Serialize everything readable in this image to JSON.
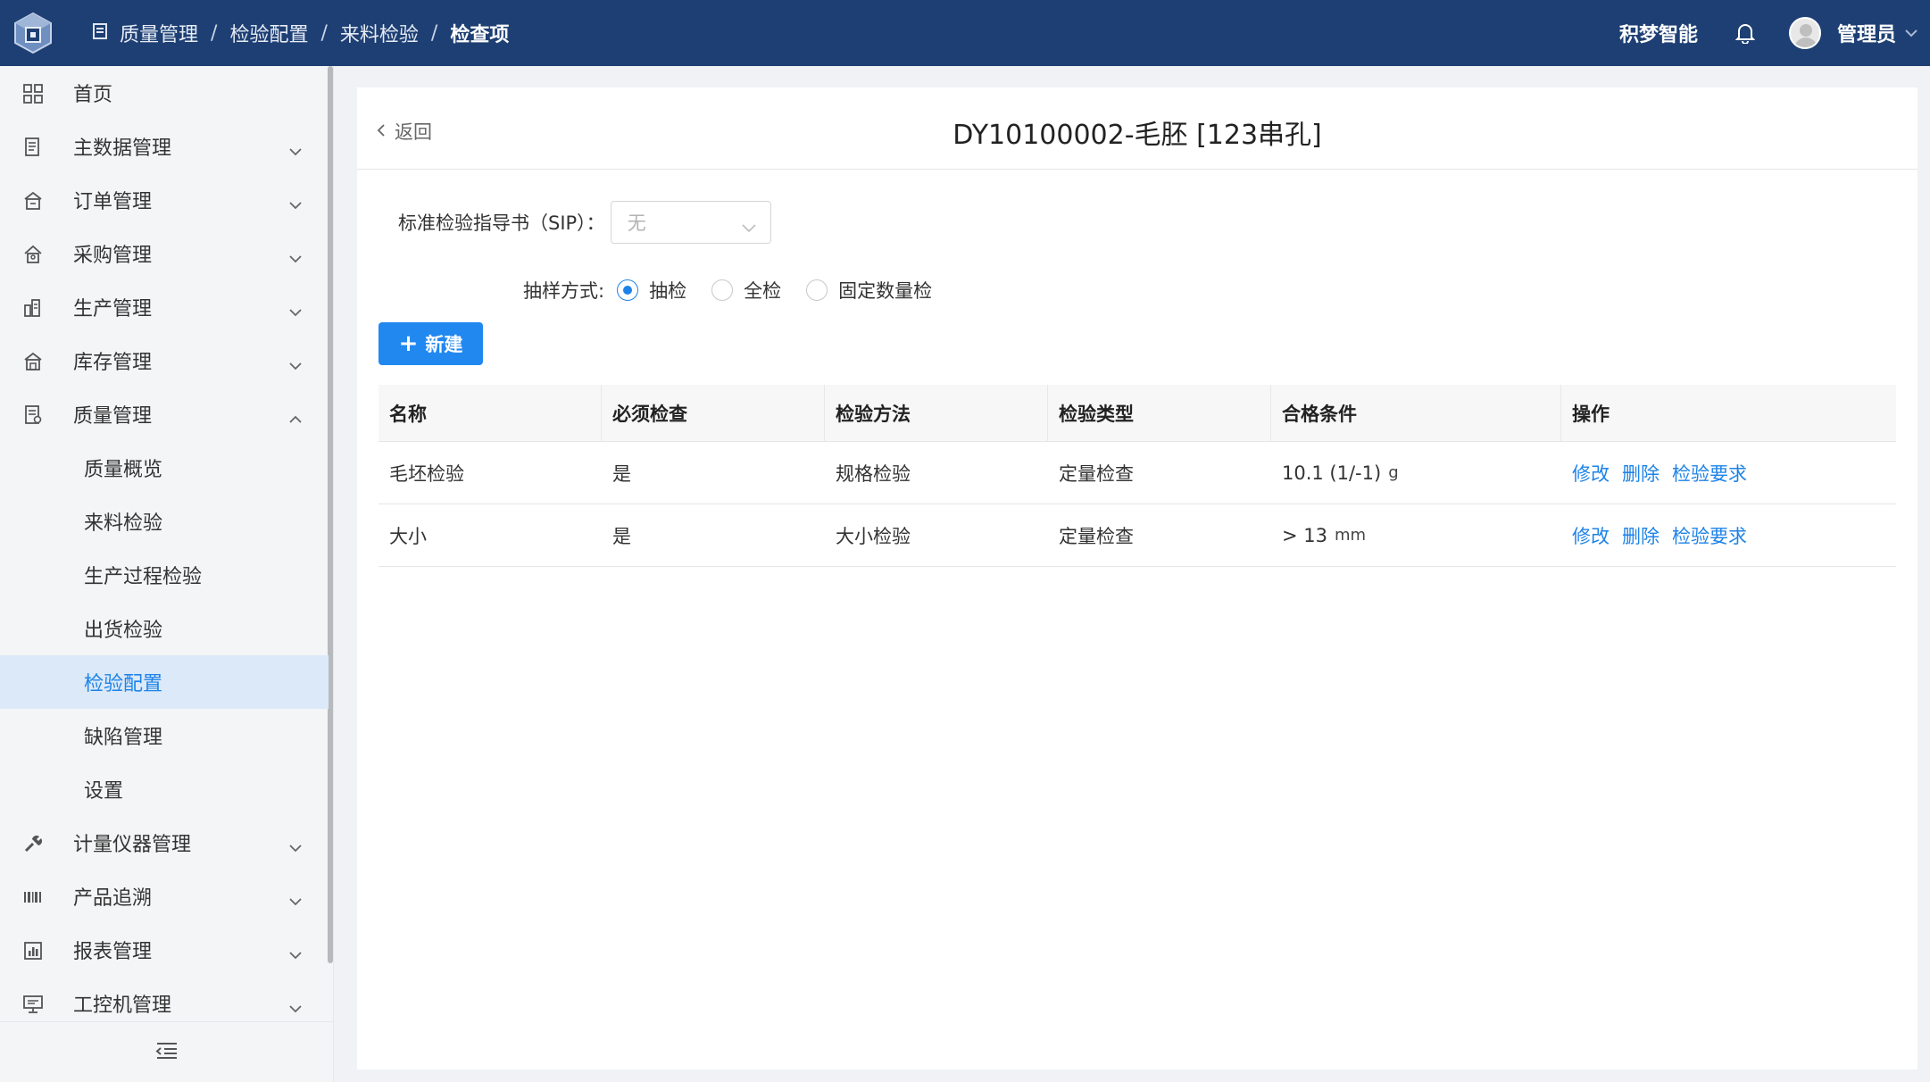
{
  "header": {
    "breadcrumb": [
      "质量管理",
      "检验配置",
      "来料检验",
      "检查项"
    ],
    "company": "积梦智能",
    "user": "管理员"
  },
  "sidebar": {
    "items": [
      {
        "label": "首页",
        "icon": "grid-icon"
      },
      {
        "label": "主数据管理",
        "icon": "master-data-icon"
      },
      {
        "label": "订单管理",
        "icon": "order-icon"
      },
      {
        "label": "采购管理",
        "icon": "purchase-icon"
      },
      {
        "label": "生产管理",
        "icon": "production-icon"
      },
      {
        "label": "库存管理",
        "icon": "inventory-icon"
      },
      {
        "label": "质量管理",
        "icon": "quality-icon"
      },
      {
        "label": "计量仪器管理",
        "icon": "wrench-icon"
      },
      {
        "label": "产品追溯",
        "icon": "barcode-icon"
      },
      {
        "label": "报表管理",
        "icon": "report-icon"
      },
      {
        "label": "工控机管理",
        "icon": "monitor-icon"
      }
    ],
    "quality_sub": [
      "质量概览",
      "来料检验",
      "生产过程检验",
      "出货检验",
      "检验配置",
      "缺陷管理",
      "设置"
    ],
    "active_sub": "检验配置"
  },
  "page": {
    "back_label": "返回",
    "title": "DY10100002-毛胚 [123串孔]",
    "sip_label": "标准检验指导书（SIP）：",
    "sip_value": "无",
    "sampling_label": "抽样方式:",
    "sampling_options": [
      "抽检",
      "全检",
      "固定数量检"
    ],
    "sampling_selected": "抽检",
    "new_button": "新建"
  },
  "table": {
    "headers": [
      "名称",
      "必须检查",
      "检验方法",
      "检验类型",
      "合格条件",
      "操作"
    ],
    "rows": [
      {
        "name": "毛坯检验",
        "required": "是",
        "method": "规格检验",
        "type": "定量检查",
        "condition": "10.1 (1/-1)",
        "unit": "g",
        "actions": [
          "修改",
          "删除",
          "检验要求"
        ]
      },
      {
        "name": "大小",
        "required": "是",
        "method": "大小检验",
        "type": "定量检查",
        "condition": "> 13",
        "unit": "mm",
        "actions": [
          "修改",
          "删除",
          "检验要求"
        ]
      }
    ]
  },
  "colors": {
    "header_bg": "#1e3f73",
    "accent": "#1d83e8",
    "active_bg": "#dbe9f8"
  }
}
